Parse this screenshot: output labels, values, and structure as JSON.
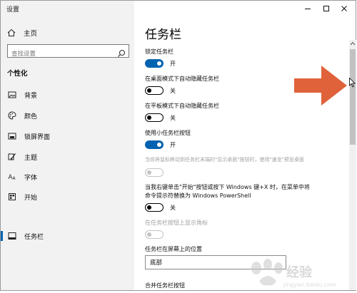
{
  "window": {
    "title": "设置"
  },
  "sidebar": {
    "home_label": "主页",
    "search_placeholder": "查找设置",
    "section_title": "个性化",
    "items": [
      {
        "label": "背景",
        "icon": "picture-icon"
      },
      {
        "label": "颜色",
        "icon": "palette-icon"
      },
      {
        "label": "锁屏界面",
        "icon": "lock-screen-icon"
      },
      {
        "label": "主题",
        "icon": "theme-brush-icon"
      },
      {
        "label": "字体",
        "icon": "font-icon"
      },
      {
        "label": "开始",
        "icon": "start-icon"
      },
      {
        "label": "任务栏",
        "icon": "taskbar-icon",
        "active": true
      }
    ]
  },
  "main": {
    "title": "任务栏",
    "settings": [
      {
        "label": "锁定任务栏",
        "state": "开",
        "on": true
      },
      {
        "label": "在桌面模式下自动隐藏任务栏",
        "state": "关",
        "on": false
      },
      {
        "label": "在平板模式下自动隐藏任务栏",
        "state": "关",
        "on": false
      },
      {
        "label": "使用小任务栏按钮",
        "state": "开",
        "on": true
      },
      {
        "label": "当你将鼠标移动到任务栏末端的\"显示桌面\"按钮时，使用\"速览\"预览桌面",
        "disabled": true
      },
      {
        "label": "当我右键单击\"开始\"按钮或按下 Windows 键+X 时，在菜单中将命令提示符替换为 Windows PowerShell",
        "state": "关",
        "on": false
      },
      {
        "label": "在任务栏按钮上显示角标",
        "disabled": true
      }
    ],
    "position_label": "任务栏在屏幕上的位置",
    "position_value": "底部",
    "combine_label": "合并任务栏按钮"
  },
  "watermark": {
    "text": "Bai经验",
    "subtext": "jingyan.baidu.com"
  },
  "colors": {
    "accent": "#0063b1",
    "sidebar_bg": "#f2f2f2",
    "arrow": "#e0623a"
  }
}
